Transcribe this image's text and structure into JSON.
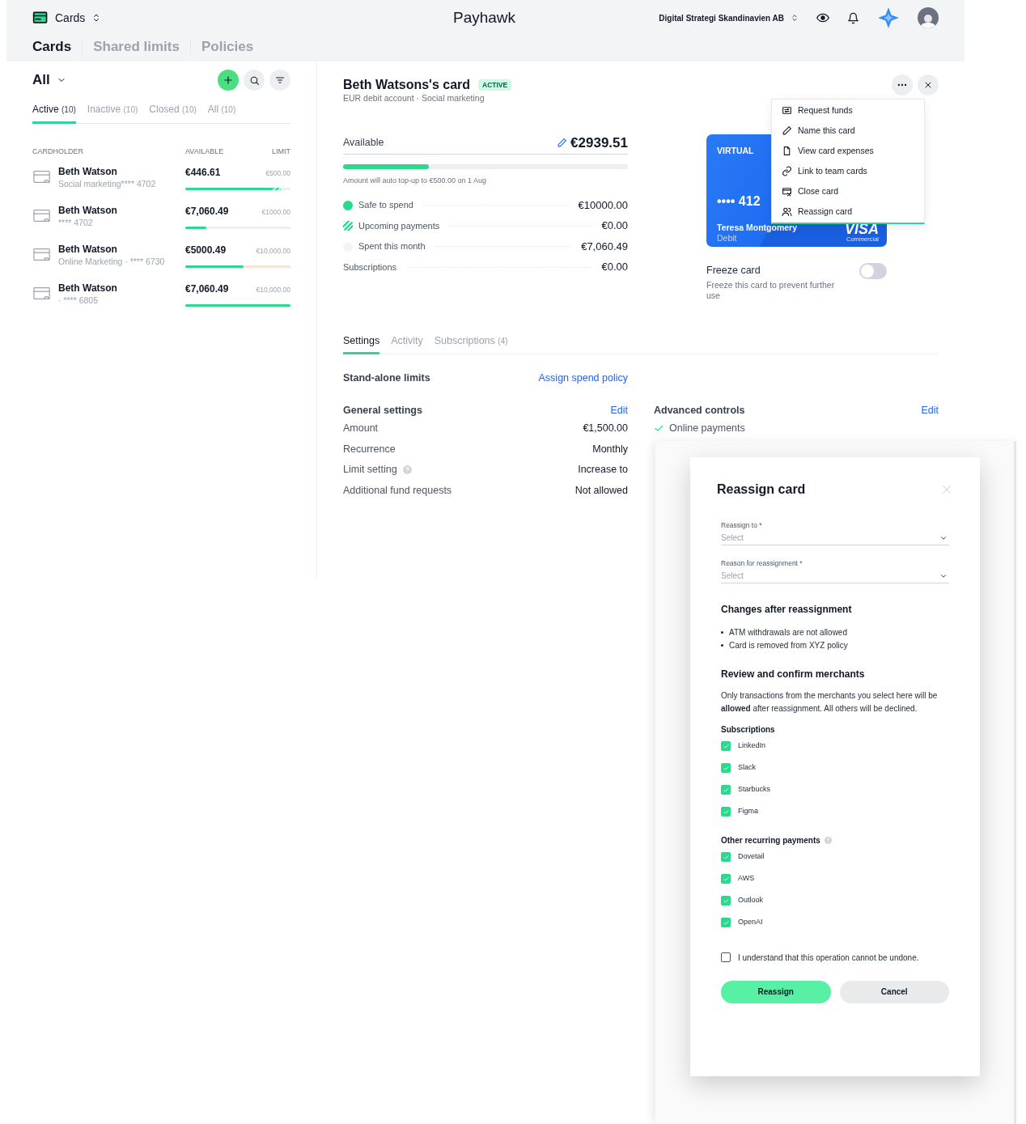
{
  "app_bar": {
    "module": "Cards",
    "brand": "Payhawk",
    "company": "Digital Strategi Skandinavien AB"
  },
  "nav_tabs": [
    {
      "label": "Cards",
      "selected": true
    },
    {
      "label": "Shared limits",
      "selected": false
    },
    {
      "label": "Policies",
      "selected": false
    }
  ],
  "card_list": {
    "filter": "All",
    "tabs": [
      {
        "label": "Active",
        "count": "(10)",
        "selected": true
      },
      {
        "label": "Inactive",
        "count": "(10)",
        "selected": false
      },
      {
        "label": "Closed",
        "count": "(10)",
        "selected": false
      },
      {
        "label": "All",
        "count": "(10)",
        "selected": false
      }
    ],
    "columns": [
      "CARDHOLDER",
      "AVAILABLE",
      "LIMIT"
    ],
    "rows": [
      {
        "name": "Beth Watson",
        "detail": "Social marketing**** 4702",
        "available": "€446.61",
        "limit": "€500.00",
        "level": 0.83,
        "upcoming": true
      },
      {
        "name": "Beth Watson",
        "detail": "**** 4702",
        "available": "€7,060.49",
        "limit": "€1000.00",
        "level": 0.2
      },
      {
        "name": "Beth Watson",
        "detail": "Online Marketing · **** 6730",
        "available": "€5000.49",
        "limit": "€10,000.00",
        "level": 0.55,
        "warning": true
      },
      {
        "name": "Beth Watson",
        "detail": "· **** 6805",
        "available": "€7,060.49",
        "limit": "€10,000.00",
        "level": 1
      }
    ]
  },
  "detail": {
    "title": "Beth Watsons's card",
    "status": "ACTIVE",
    "subtitle": "EUR debit account · Social marketing",
    "available_label": "Available",
    "available_amount": "€2939.51",
    "level": 0.3,
    "note": "Amount will auto top-up to €500.00 on 1 Aug",
    "breakdown": [
      {
        "kind": "dot",
        "label": "Safe to spend",
        "value": "€10000.00"
      },
      {
        "kind": "hatch",
        "label": "Upcoming payments",
        "value": "€0.00"
      },
      {
        "kind": "empty",
        "label": "Spent this month",
        "value": "€7,060.49"
      },
      {
        "kind": "none",
        "label": "Subscriptions",
        "value": "€0.00"
      }
    ],
    "card": {
      "type": "VIRTUAL",
      "number": "•••• 412",
      "holder": "Teresa Montgomery",
      "funding": "Debit",
      "network": "VISA",
      "network_sub": "Commercial"
    },
    "freeze": {
      "title": "Freeze card",
      "description": "Freeze this card to prevent further use",
      "on": false
    },
    "tabs": [
      {
        "label": "Settings",
        "selected": true
      },
      {
        "label": "Activity",
        "selected": false
      },
      {
        "label": "Subscriptions",
        "count": "(4)",
        "selected": false
      }
    ],
    "standalone": {
      "label": "Stand-alone limits",
      "link": "Assign spend policy"
    },
    "general": {
      "title": "General settings",
      "edit": "Edit",
      "rows": [
        {
          "label": "Amount",
          "value": "€1,500.00"
        },
        {
          "label": "Recurrence",
          "value": "Monthly"
        },
        {
          "label": "Limit setting",
          "value": "Increase to",
          "help": true
        },
        {
          "label": "Additional fund requests",
          "value": "Not allowed"
        }
      ]
    },
    "advanced": {
      "title": "Advanced controls",
      "edit": "Edit",
      "items": [
        "Online payments"
      ]
    }
  },
  "menu": [
    {
      "label": "Request funds"
    },
    {
      "label": "Name this card"
    },
    {
      "label": "View card expenses"
    },
    {
      "label": "Link to team cards"
    },
    {
      "label": "Close card"
    },
    {
      "label": "Reassign card"
    }
  ],
  "modal": {
    "title": "Reassign card",
    "fields": [
      {
        "label": "Reassign to *",
        "placeholder": "Select"
      },
      {
        "label": "Reason for reassignment *",
        "placeholder": "Select"
      }
    ],
    "changes_title": "Changes after reassignment",
    "changes": [
      "ATM withdrawals are not allowed",
      "Card is removed from XYZ policy"
    ],
    "review_title": "Review and confirm merchants",
    "review_text": "Only transactions from the merchants you select here will be **allowed** after reassignment. All others will be declined.",
    "groups": [
      {
        "title": "Subscriptions",
        "items": [
          {
            "label": "LinkedIn",
            "checked": true
          },
          {
            "label": "Slack",
            "checked": true
          },
          {
            "label": "Starbucks",
            "checked": true
          },
          {
            "label": "Figma",
            "checked": true
          }
        ]
      },
      {
        "title": "Other recurring payments",
        "help": true,
        "items": [
          {
            "label": "Dovetail",
            "checked": true
          },
          {
            "label": "AWS",
            "checked": true
          },
          {
            "label": "Outlook",
            "checked": true
          },
          {
            "label": "OpenAI",
            "checked": true
          }
        ]
      }
    ],
    "confirm": {
      "label": "I understand that this operation cannot be undone.",
      "checked": false
    },
    "buttons": [
      {
        "label": "Reassign",
        "kind": "primary"
      },
      {
        "label": "Cancel",
        "kind": "secondary"
      }
    ]
  }
}
